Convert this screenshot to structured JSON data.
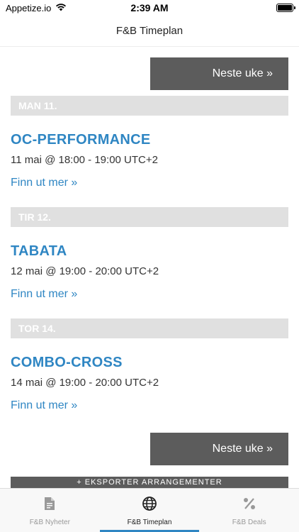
{
  "status_bar": {
    "carrier": "Appetize.io",
    "time": "2:39 AM"
  },
  "nav": {
    "title": "F&B Timeplan"
  },
  "next_week_label": "Neste uke »",
  "days": [
    {
      "header": "MAN 11.",
      "event_title": "OC-PERFORMANCE",
      "event_time": "11 mai @ 18:00 - 19:00 UTC+2",
      "link": "Finn ut mer »"
    },
    {
      "header": "TIR 12.",
      "event_title": "TABATA",
      "event_time": "12 mai @ 19:00 - 20:00 UTC+2",
      "link": "Finn ut mer »"
    },
    {
      "header": "TOR 14.",
      "event_title": "COMBO-CROSS",
      "event_time": "14 mai @ 19:00 - 20:00 UTC+2",
      "link": "Finn ut mer »"
    }
  ],
  "export_label": "+ EKSPORTER ARRANGEMENTER",
  "tabs": [
    {
      "label": "F&B Nyheter",
      "icon": "document-icon",
      "active": false
    },
    {
      "label": "F&B Timeplan",
      "icon": "globe-icon",
      "active": true
    },
    {
      "label": "F&B Deals",
      "icon": "percent-icon",
      "active": false
    }
  ],
  "colors": {
    "accent": "#2f86c3",
    "button": "#5c5c5c",
    "day_header": "#e0e0e0"
  }
}
